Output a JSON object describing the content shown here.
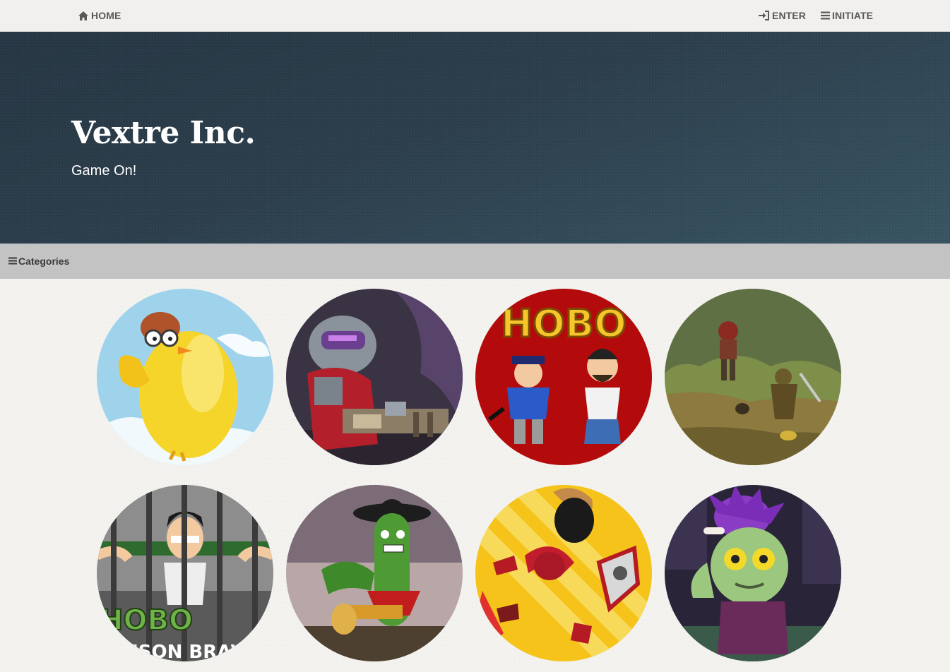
{
  "nav": {
    "home_label": "HOME",
    "enter_label": "ENTER",
    "initiate_label": "INITIATE",
    "icons": {
      "home": "home-icon",
      "enter": "sign-in-icon",
      "initiate": "menu-icon"
    }
  },
  "hero": {
    "title": "Vextre Inc.",
    "subtitle": "Game On!"
  },
  "categories": {
    "label": "Categories",
    "icon": "menu-icon"
  },
  "games": [
    {
      "thumbnail": "flying yellow chicken pilot",
      "accent": "#f6d52a"
    },
    {
      "thumbnail": "armored soldier with gun",
      "accent": "#c3272f"
    },
    {
      "thumbnail": "hobo and policeman",
      "accent": "#b30b0b",
      "art_text": "HOBO"
    },
    {
      "thumbnail": "knight fighting in swamp",
      "accent": "#6c7d3a"
    },
    {
      "thumbnail": "hobo in prison",
      "accent": "#6a6a6a",
      "art_text": "HOBO",
      "art_subtext": "PRISON BRAWL"
    },
    {
      "thumbnail": "cactus cowboy with blunderbuss",
      "accent": "#4e9a35"
    },
    {
      "thumbnail": "stickman knight battle",
      "accent": "#f5c31a"
    },
    {
      "thumbnail": "purple-haired zombie",
      "accent": "#7fb26d"
    }
  ],
  "colors": {
    "nav_bg": "#f1f0ef",
    "hero_bg": "#2c3e4c",
    "category_bar_bg": "#c3c3c3",
    "page_bg": "#f3f2ef"
  }
}
